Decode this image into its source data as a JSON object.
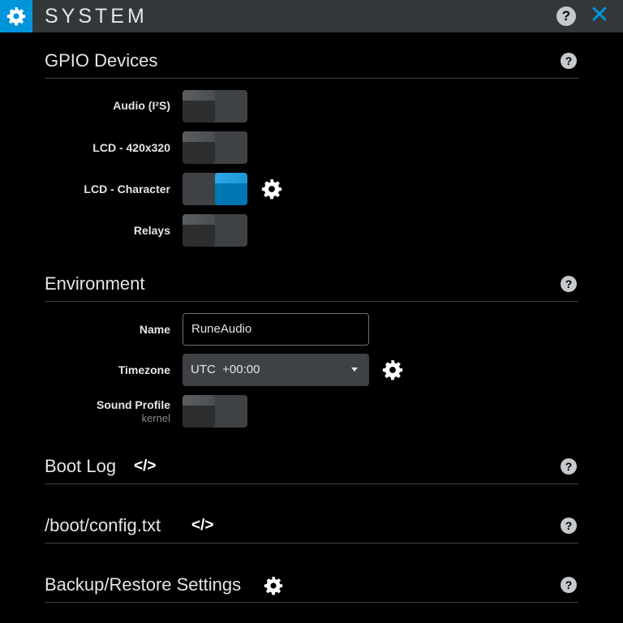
{
  "app": {
    "title": "SYSTEM",
    "title_icon": "gear-icon",
    "accent_color": "#0095d8"
  },
  "sections": {
    "gpio": {
      "title": "GPIO Devices",
      "rows": [
        {
          "label": "Audio (I²S)",
          "state": "off"
        },
        {
          "label": "LCD - 420x320",
          "state": "off"
        },
        {
          "label": "LCD - Character",
          "state": "on"
        },
        {
          "label": "Relays",
          "state": "off"
        }
      ]
    },
    "environment": {
      "title": "Environment",
      "name_label": "Name",
      "name_value": "RuneAudio",
      "timezone_label": "Timezone",
      "timezone_value": "UTC  +00:00",
      "sound_profile_label": "Sound Profile",
      "sound_profile_sub": "kernel",
      "sound_profile_state": "off"
    },
    "bootlog": {
      "title": "Boot Log"
    },
    "config": {
      "title": "/boot/config.txt"
    },
    "backup": {
      "title": "Backup/Restore Settings"
    }
  },
  "icons": {
    "help": "?",
    "close": "✕",
    "code": "</>"
  }
}
